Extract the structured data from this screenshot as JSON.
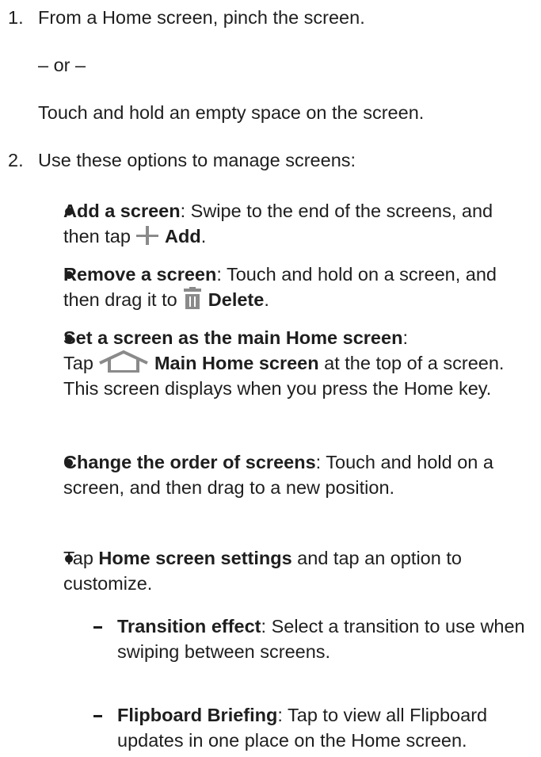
{
  "steps": [
    {
      "number": "1.",
      "text": "From a Home screen, pinch the screen.",
      "or_label": "– or –",
      "alt_text": "Touch and hold an empty space on the screen."
    },
    {
      "number": "2.",
      "text": "Use these options to manage screens:"
    }
  ],
  "options": [
    {
      "term": "Add a screen",
      "sep": ":",
      "text_before_icon": " Swipe to the end of the screens, and then tap ",
      "icon": "plus-icon",
      "action": "Add",
      "text_after": "."
    },
    {
      "term": "Remove a screen",
      "sep": ":",
      "text_before_icon": " Touch and hold on a screen, and then drag it to ",
      "icon": "trash-icon",
      "action": "Delete",
      "text_after": "."
    },
    {
      "term": "Set a screen as the main Home screen",
      "sep": ":",
      "text_before_icon": "Tap ",
      "icon": "home-icon",
      "action": "Main Home screen",
      "text_after": " at the top of a screen. This screen displays when you press the Home key."
    },
    {
      "term": "Change the order of screens",
      "sep": ":",
      "text": " Touch and hold on a screen, and then drag to a new position."
    },
    {
      "prefix": "Tap ",
      "term": "Home screen settings",
      "text": " and tap an option to customize."
    }
  ],
  "settings": [
    {
      "term": "Transition effect",
      "sep": ":",
      "text": " Select a transition to use when swiping between screens."
    },
    {
      "term": "Flipboard Briefing",
      "sep": ":",
      "text": " Tap to view all Flipboard updates in one place on the Home screen."
    }
  ],
  "colors": {
    "text": "#1e1e1e",
    "icon_gray": "#8a8a8a"
  }
}
